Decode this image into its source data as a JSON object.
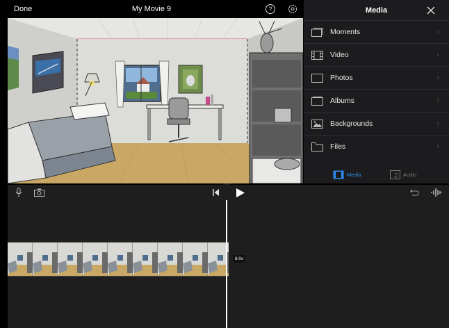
{
  "top_bar": {
    "done_label": "Done",
    "title": "My Movie 9",
    "help_glyph": "?"
  },
  "media": {
    "title": "Media",
    "items": [
      {
        "label": "Moments",
        "icon": "moments-icon"
      },
      {
        "label": "Video",
        "icon": "video-icon"
      },
      {
        "label": "Photos",
        "icon": "photos-icon"
      },
      {
        "label": "Albums",
        "icon": "albums-icon"
      },
      {
        "label": "Backgrounds",
        "icon": "backgrounds-icon"
      },
      {
        "label": "Files",
        "icon": "files-icon"
      }
    ],
    "tabs": [
      {
        "label": "Media",
        "active": true
      },
      {
        "label": "Audio",
        "active": false
      }
    ],
    "chevron": "›"
  },
  "timeline": {
    "clip_duration": "8.0s",
    "frame_count": 9
  },
  "colors": {
    "accent": "#2d8cf0",
    "panel_bg": "#1c1c1e",
    "timeline_bg": "#1e1e1e"
  }
}
